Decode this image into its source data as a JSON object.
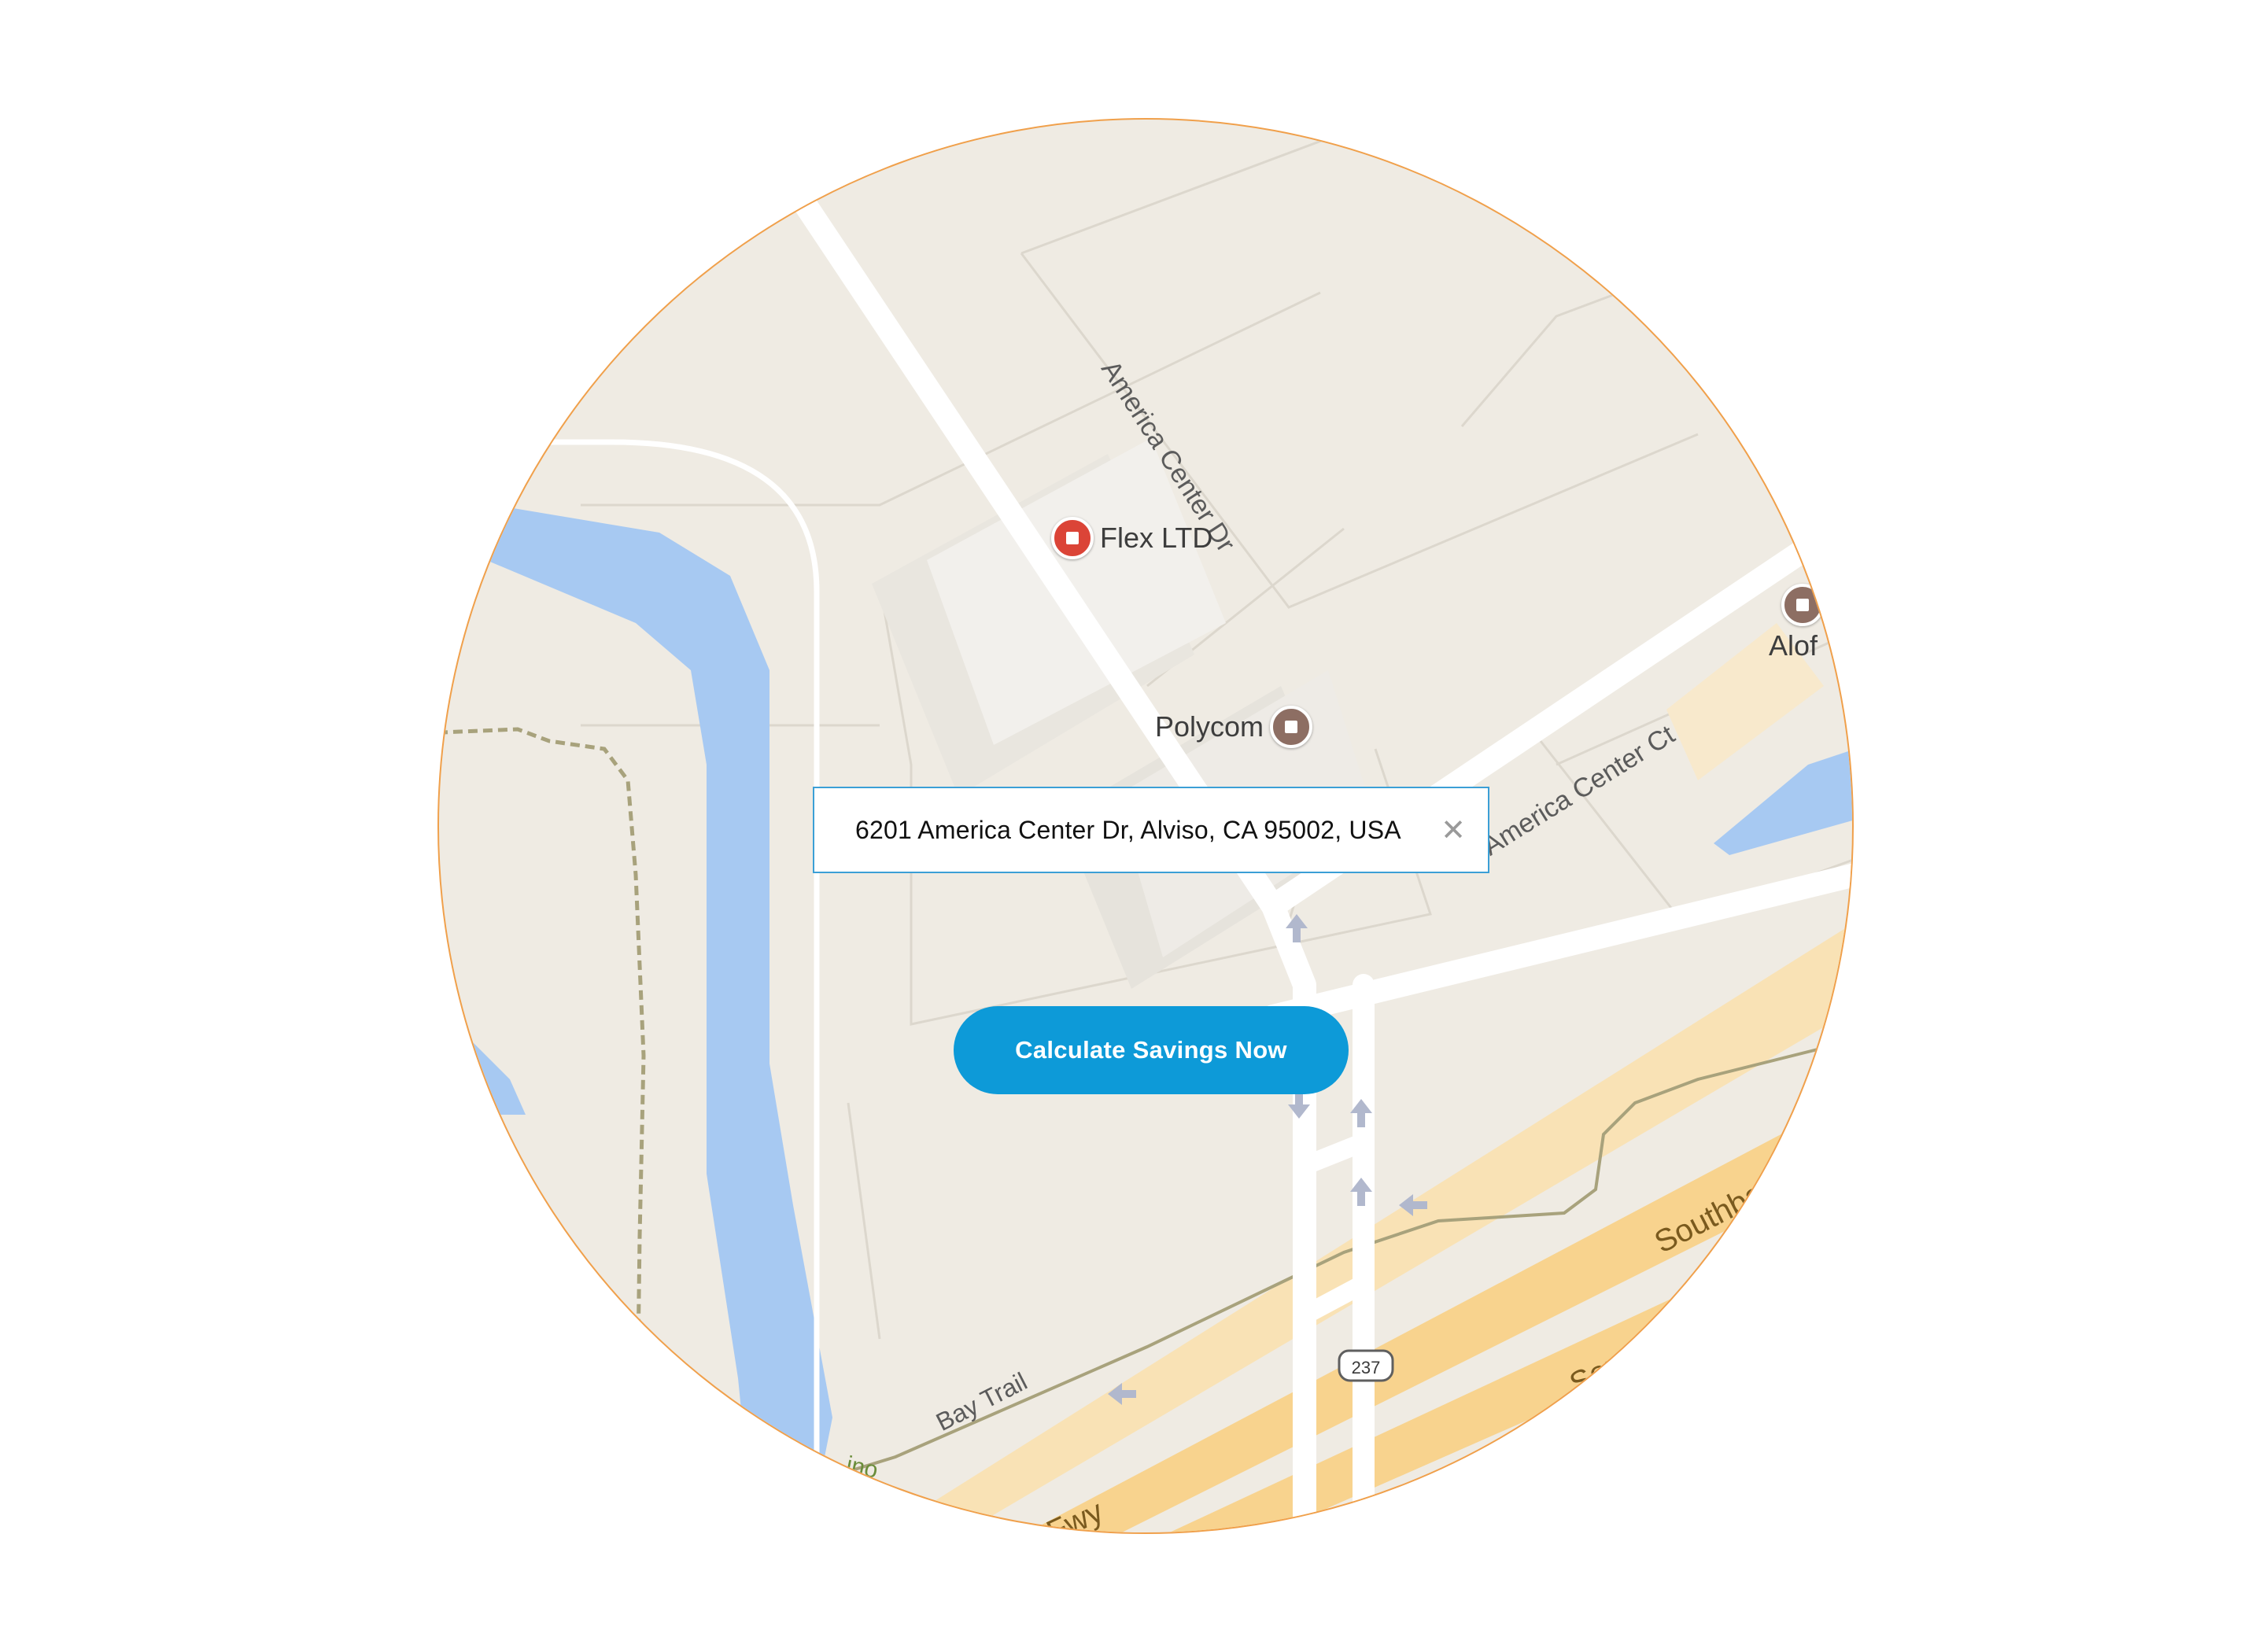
{
  "map": {
    "streets": {
      "america_center_dr": "America Center Dr",
      "america_center_ct": "America Center Ct",
      "bay_trail": "Bay Trail",
      "southbay_fwy_1": "Southbay",
      "southbay_fwy_2": "Southbo",
      "fwy_fragment": "Fwy",
      "trail_fragment": "ino"
    },
    "highway_shield": "237",
    "pois": {
      "flex": {
        "name": "Flex LTD",
        "color": "#db4437"
      },
      "polycom": {
        "name": "Polycom",
        "color": "#8d6e63"
      },
      "aloft": {
        "name": "Alof",
        "color": "#8d6e63"
      }
    }
  },
  "address_input": {
    "value": "6201 America Center Dr, Alviso, CA 95002, USA",
    "clear_symbol": "✕"
  },
  "cta": {
    "label": "Calculate Savings Now",
    "color": "#0d9ad8"
  }
}
